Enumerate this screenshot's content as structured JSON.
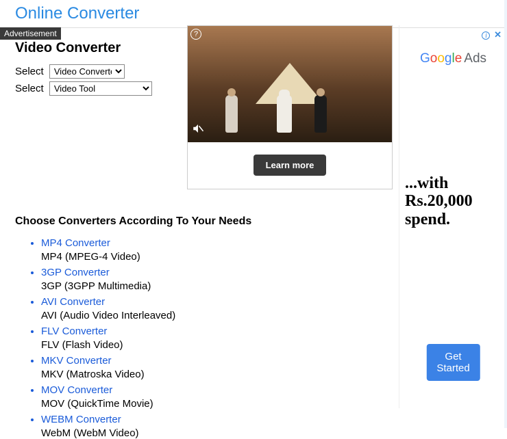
{
  "site_title": "Online Converter",
  "adv_label": "Advertisement",
  "page_title": "Video Converter",
  "selects": {
    "label": "Select",
    "converter_selected": "Video Converter",
    "tool_selected": "Video Tool"
  },
  "choose_heading": "Choose Converters According To Your Needs",
  "converters": [
    {
      "name": "MP4 Converter",
      "desc": "MP4 (MPEG-4 Video)"
    },
    {
      "name": "3GP Converter",
      "desc": "3GP (3GPP Multimedia)"
    },
    {
      "name": "AVI Converter",
      "desc": "AVI (Audio Video Interleaved)"
    },
    {
      "name": "FLV Converter",
      "desc": "FLV (Flash Video)"
    },
    {
      "name": "MKV Converter",
      "desc": "MKV (Matroska Video)"
    },
    {
      "name": "MOV Converter",
      "desc": "MOV (QuickTime Movie)"
    },
    {
      "name": "WEBM Converter",
      "desc": "WebM (WebM Video)"
    }
  ],
  "main_ad": {
    "cta": "Learn more"
  },
  "side_ad": {
    "logo_g1": "G",
    "logo_o1": "o",
    "logo_o2": "o",
    "logo_g2": "g",
    "logo_l": "l",
    "logo_e": "e",
    "logo_ads": "Ads",
    "text": "...with Rs.20,000 spend.",
    "cta": "Get Started"
  }
}
